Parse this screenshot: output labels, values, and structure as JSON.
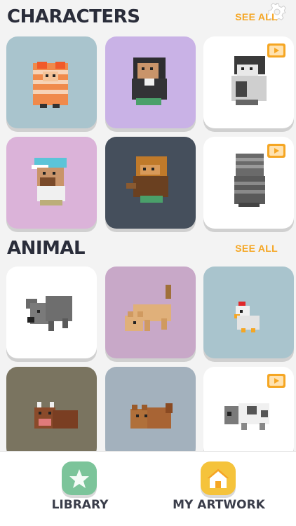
{
  "sections": {
    "characters": {
      "title": "CHARACTERS",
      "see_all": "SEE ALL"
    },
    "animal": {
      "title": "ANIMAL",
      "see_all": "SEE ALL"
    }
  },
  "tabs": [
    {
      "label": "LIBRARY",
      "icon": "star-icon",
      "color": "#7cc49a"
    },
    {
      "label": "MY ARTWORK",
      "icon": "house-icon",
      "color": "#f5c33b"
    }
  ],
  "colors": {
    "accent": "#f5a623",
    "title": "#2a2d3a"
  }
}
